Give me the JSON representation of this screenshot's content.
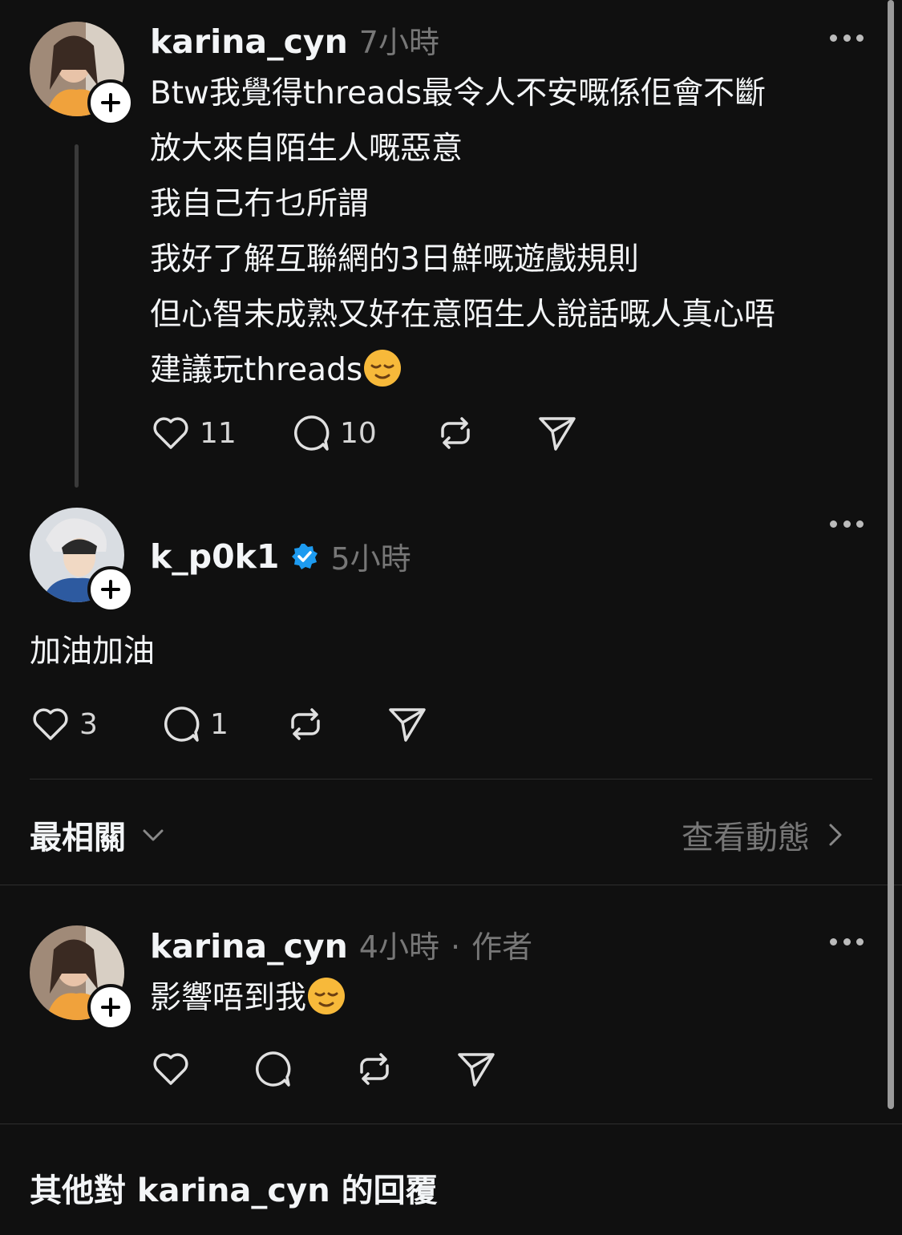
{
  "post1": {
    "username": "karina_cyn",
    "time": "7小時",
    "lines": [
      "Btw我覺得threads最令人不安嘅係佢會不斷",
      "放大來自陌生人嘅惡意",
      "我自己冇乜所謂",
      "我好了解互聯網的3日鮮嘅遊戲規則",
      "但心智未成熟又好在意陌生人說話嘅人真心唔",
      "建議玩threads"
    ],
    "likes": "11",
    "replies": "10"
  },
  "post2": {
    "username": "k_p0k1",
    "time": "5小時",
    "text": "加油加油",
    "likes": "3",
    "replies": "1"
  },
  "sort_bar": {
    "label": "最相關",
    "activity_link": "查看動態"
  },
  "post3": {
    "username": "karina_cyn",
    "time": "4小時",
    "separator": "·",
    "author_tag": "作者",
    "text": "影響唔到我"
  },
  "footer": {
    "heading": "其他對 karina_cyn 的回覆"
  },
  "colors": {
    "background": "#101010",
    "verified": "#1d9bf0",
    "muted": "#777777"
  }
}
